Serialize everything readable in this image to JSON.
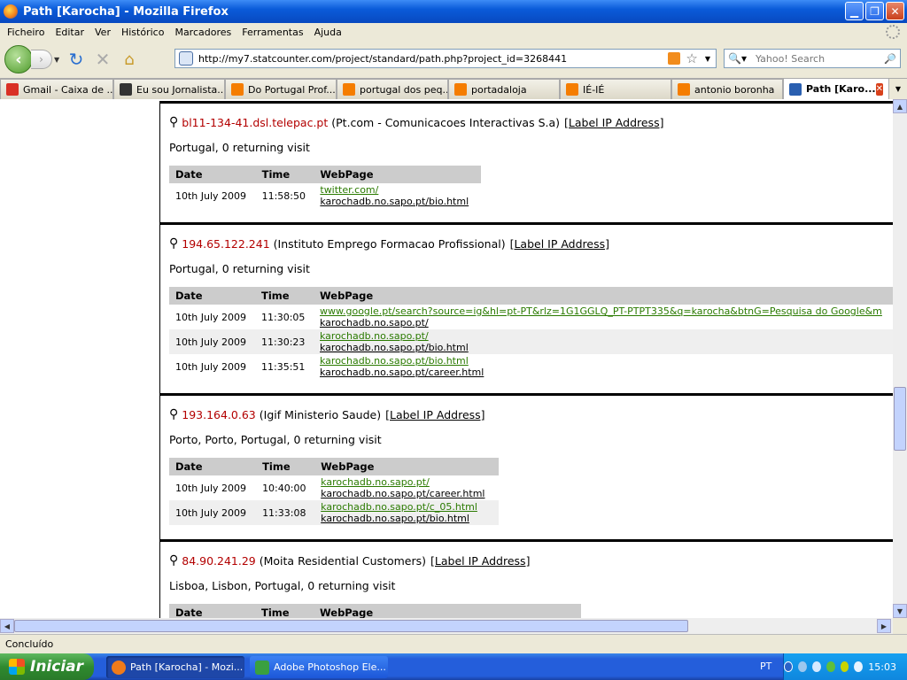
{
  "window": {
    "title": "Path [Karocha] - Mozilla Firefox"
  },
  "menu": [
    "Ficheiro",
    "Editar",
    "Ver",
    "Histórico",
    "Marcadores",
    "Ferramentas",
    "Ajuda"
  ],
  "address": {
    "url": "http://my7.statcounter.com/project/standard/path.php?project_id=3268441"
  },
  "search": {
    "placeholder": "Yahoo! Search"
  },
  "tabs": [
    {
      "label": "Gmail - Caixa de ...",
      "color": "#d93025"
    },
    {
      "label": "Eu sou Jornalista...",
      "color": "#333333"
    },
    {
      "label": "Do Portugal Prof...",
      "color": "#f57d00"
    },
    {
      "label": "portugal dos peq...",
      "color": "#f57d00"
    },
    {
      "label": "portadaloja",
      "color": "#f57d00"
    },
    {
      "label": "IÉ-IÉ",
      "color": "#f57d00"
    },
    {
      "label": "antonio boronha",
      "color": "#f57d00"
    },
    {
      "label": "Path [Karo...",
      "color": "#2a5fb0"
    }
  ],
  "table_headers": {
    "date": "Date",
    "time": "Time",
    "page": "WebPage"
  },
  "label_link": "[Label IP Address]",
  "entries": [
    {
      "ip": "bl11-134-41.dsl.telepac.pt",
      "org": "(Pt.com - Comunicacoes Interactivas S.a)",
      "location": "Portugal, 0 returning visit",
      "visits": [
        {
          "date": "10th July 2009",
          "time": "11:58:50",
          "ref": "twitter.com/",
          "page": "karochadb.no.sapo.pt/bio.html"
        }
      ]
    },
    {
      "ip": "194.65.122.241",
      "org": "(Instituto Emprego Formacao Profissional)",
      "location": "Portugal, 0 returning visit",
      "visits": [
        {
          "date": "10th July 2009",
          "time": "11:30:05",
          "ref": "www.google.pt/search?source=ig&hl=pt-PT&rlz=1G1GGLQ_PT-PTPT335&q=karocha&btnG=Pesquisa do Google&m",
          "page": "karochadb.no.sapo.pt/"
        },
        {
          "date": "10th July 2009",
          "time": "11:30:23",
          "ref": "karochadb.no.sapo.pt/",
          "page": "karochadb.no.sapo.pt/bio.html"
        },
        {
          "date": "10th July 2009",
          "time": "11:35:51",
          "ref": "karochadb.no.sapo.pt/bio.html",
          "page": "karochadb.no.sapo.pt/career.html"
        }
      ]
    },
    {
      "ip": "193.164.0.63",
      "org": "(Igif Ministerio Saude)",
      "location": "Porto, Porto, Portugal, 0 returning visit",
      "visits": [
        {
          "date": "10th July 2009",
          "time": "10:40:00",
          "ref": "karochadb.no.sapo.pt/",
          "page": "karochadb.no.sapo.pt/career.html"
        },
        {
          "date": "10th July 2009",
          "time": "11:33:08",
          "ref": "karochadb.no.sapo.pt/c_05.html",
          "page": "karochadb.no.sapo.pt/bio.html"
        }
      ]
    },
    {
      "ip": "84.90.241.29",
      "org": "(Moita Residential Customers)",
      "location": "Lisboa, Lisbon, Portugal, 0 returning visit",
      "visits": []
    }
  ],
  "status": {
    "text": "Concluído"
  },
  "taskbar": {
    "start": "Iniciar",
    "tasks": [
      {
        "label": "Path [Karocha] - Mozi...",
        "color": "#f07b1a"
      },
      {
        "label": "Adobe Photoshop Ele...",
        "color": "#3aa040"
      }
    ],
    "lang": "PT",
    "clock": "15:03"
  }
}
